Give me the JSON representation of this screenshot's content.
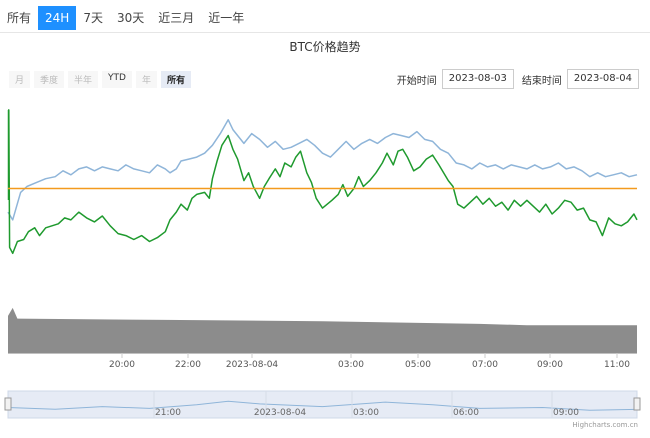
{
  "tabs": [
    {
      "label": "所有",
      "active": false
    },
    {
      "label": "24H",
      "active": true
    },
    {
      "label": "7天",
      "active": false
    },
    {
      "label": "30天",
      "active": false
    },
    {
      "label": "近三月",
      "active": false
    },
    {
      "label": "近一年",
      "active": false
    }
  ],
  "range_buttons": [
    {
      "label": "月",
      "state": "disabled"
    },
    {
      "label": "季度",
      "state": "disabled"
    },
    {
      "label": "半年",
      "state": "disabled"
    },
    {
      "label": "YTD",
      "state": "enabled"
    },
    {
      "label": "年",
      "state": "disabled"
    },
    {
      "label": "所有",
      "state": "selected"
    }
  ],
  "date_range": {
    "start_label": "开始时间",
    "start_value": "2023-08-03",
    "end_label": "结束时间",
    "end_value": "2023-08-04"
  },
  "credit": "Highcharts.com.cn",
  "colors": {
    "active_tab": "#1e90ff",
    "blue": "#8fb5d9",
    "green": "#1f9a2e",
    "orange": "#f39a1e",
    "volume": "#8c8c8c"
  },
  "chart_data": {
    "type": "line",
    "title": "BTC价格趋势",
    "x_start": "2023-08-03 18:30",
    "x_end": "2023-08-04 11:30",
    "x_tick_labels": [
      "20:00",
      "22:00",
      "2023-08-04",
      "03:00",
      "05:00",
      "07:00",
      "09:00",
      "11:00"
    ],
    "navigator_tick_labels": [
      "21:00",
      "2023-08-04",
      "03:00",
      "06:00",
      "09:00"
    ],
    "baseline": 0,
    "series": [
      {
        "color": "#8fb5d9",
        "points": [
          [
            0,
            -1.2
          ],
          [
            0.3,
            -1.6
          ],
          [
            0.8,
            -0.2
          ],
          [
            1.2,
            0.1
          ],
          [
            1.8,
            0.3
          ],
          [
            2.4,
            0.5
          ],
          [
            3.0,
            0.6
          ],
          [
            3.5,
            0.9
          ],
          [
            4.0,
            0.7
          ],
          [
            4.5,
            1.0
          ],
          [
            5.0,
            1.1
          ],
          [
            5.5,
            0.9
          ],
          [
            6.0,
            1.1
          ],
          [
            6.5,
            1.0
          ],
          [
            7.0,
            0.9
          ],
          [
            7.5,
            1.2
          ],
          [
            8.0,
            1.0
          ],
          [
            8.5,
            0.9
          ],
          [
            9.0,
            0.8
          ],
          [
            9.5,
            1.2
          ],
          [
            10.0,
            1.0
          ],
          [
            10.3,
            0.8
          ],
          [
            10.7,
            1.0
          ],
          [
            11.0,
            1.4
          ],
          [
            11.5,
            1.5
          ],
          [
            12.0,
            1.6
          ],
          [
            12.5,
            1.8
          ],
          [
            13.0,
            2.2
          ],
          [
            13.5,
            2.8
          ],
          [
            14.0,
            3.5
          ],
          [
            14.3,
            3.0
          ],
          [
            14.7,
            2.6
          ],
          [
            15.0,
            2.3
          ],
          [
            15.5,
            2.8
          ],
          [
            16.0,
            2.5
          ],
          [
            16.5,
            2.1
          ],
          [
            17.0,
            2.4
          ],
          [
            17.5,
            2.0
          ],
          [
            18.0,
            2.1
          ],
          [
            18.5,
            2.3
          ],
          [
            19.0,
            2.5
          ],
          [
            19.5,
            2.2
          ],
          [
            20.0,
            1.8
          ],
          [
            20.5,
            1.6
          ],
          [
            21.0,
            2.0
          ],
          [
            21.5,
            2.4
          ],
          [
            22.0,
            2.0
          ],
          [
            22.5,
            2.3
          ],
          [
            23.0,
            2.5
          ],
          [
            23.5,
            2.3
          ],
          [
            24.0,
            2.6
          ],
          [
            24.5,
            2.8
          ],
          [
            25.0,
            2.7
          ],
          [
            25.5,
            2.6
          ],
          [
            26.0,
            2.9
          ],
          [
            26.5,
            2.5
          ],
          [
            27.0,
            2.4
          ],
          [
            27.5,
            2.0
          ],
          [
            28.0,
            1.8
          ],
          [
            28.5,
            1.3
          ],
          [
            29.0,
            1.2
          ],
          [
            29.5,
            1.0
          ],
          [
            30.0,
            1.3
          ],
          [
            30.5,
            1.1
          ],
          [
            31.0,
            1.2
          ],
          [
            31.5,
            1.0
          ],
          [
            32.0,
            1.2
          ],
          [
            32.5,
            1.1
          ],
          [
            33.0,
            1.0
          ],
          [
            33.5,
            1.2
          ],
          [
            34.0,
            1.0
          ],
          [
            34.5,
            1.1
          ],
          [
            35.0,
            1.3
          ],
          [
            35.5,
            1.0
          ],
          [
            36.0,
            1.1
          ],
          [
            36.5,
            0.9
          ],
          [
            37.0,
            0.6
          ],
          [
            37.5,
            0.8
          ],
          [
            38.0,
            0.6
          ],
          [
            38.5,
            0.7
          ],
          [
            39.0,
            0.8
          ],
          [
            39.5,
            0.6
          ],
          [
            40.0,
            0.7
          ]
        ]
      },
      {
        "color": "#1f9a2e",
        "points": [
          [
            0,
            4.0
          ],
          [
            0.05,
            4.0
          ],
          [
            0.1,
            -3.0
          ],
          [
            0.3,
            -3.3
          ],
          [
            0.6,
            -2.7
          ],
          [
            1.0,
            -2.6
          ],
          [
            1.3,
            -2.2
          ],
          [
            1.7,
            -2.0
          ],
          [
            2.0,
            -2.4
          ],
          [
            2.4,
            -2.0
          ],
          [
            2.8,
            -1.9
          ],
          [
            3.2,
            -1.8
          ],
          [
            3.6,
            -1.5
          ],
          [
            4.0,
            -1.6
          ],
          [
            4.5,
            -1.2
          ],
          [
            5.0,
            -1.5
          ],
          [
            5.5,
            -1.7
          ],
          [
            6.0,
            -1.4
          ],
          [
            6.5,
            -1.9
          ],
          [
            7.0,
            -2.3
          ],
          [
            7.5,
            -2.4
          ],
          [
            8.0,
            -2.6
          ],
          [
            8.5,
            -2.4
          ],
          [
            9.0,
            -2.7
          ],
          [
            9.5,
            -2.5
          ],
          [
            10.0,
            -2.2
          ],
          [
            10.3,
            -1.6
          ],
          [
            10.7,
            -1.2
          ],
          [
            11.0,
            -0.8
          ],
          [
            11.4,
            -1.1
          ],
          [
            11.7,
            -0.5
          ],
          [
            12.0,
            -0.3
          ],
          [
            12.5,
            -0.2
          ],
          [
            12.8,
            -0.5
          ],
          [
            13.0,
            0.5
          ],
          [
            13.3,
            1.4
          ],
          [
            13.6,
            2.2
          ],
          [
            14.0,
            2.7
          ],
          [
            14.3,
            2.0
          ],
          [
            14.6,
            1.5
          ],
          [
            15.0,
            0.4
          ],
          [
            15.3,
            0.8
          ],
          [
            15.6,
            0.1
          ],
          [
            16.0,
            -0.5
          ],
          [
            16.3,
            0.1
          ],
          [
            16.6,
            0.5
          ],
          [
            17.0,
            1.0
          ],
          [
            17.3,
            0.6
          ],
          [
            17.6,
            1.3
          ],
          [
            18.0,
            1.1
          ],
          [
            18.3,
            1.6
          ],
          [
            18.6,
            1.9
          ],
          [
            19.0,
            0.8
          ],
          [
            19.3,
            0.3
          ],
          [
            19.6,
            -0.5
          ],
          [
            20.0,
            -1.0
          ],
          [
            20.3,
            -0.8
          ],
          [
            20.6,
            -0.6
          ],
          [
            21.0,
            -0.3
          ],
          [
            21.3,
            0.2
          ],
          [
            21.6,
            -0.4
          ],
          [
            22.0,
            0.0
          ],
          [
            22.3,
            0.6
          ],
          [
            22.6,
            0.1
          ],
          [
            23.0,
            0.4
          ],
          [
            23.4,
            0.8
          ],
          [
            23.8,
            1.3
          ],
          [
            24.1,
            1.8
          ],
          [
            24.5,
            1.2
          ],
          [
            24.8,
            1.9
          ],
          [
            25.1,
            2.0
          ],
          [
            25.4,
            1.6
          ],
          [
            25.8,
            0.9
          ],
          [
            26.2,
            1.1
          ],
          [
            26.6,
            1.5
          ],
          [
            27.0,
            1.7
          ],
          [
            27.4,
            1.2
          ],
          [
            27.7,
            0.8
          ],
          [
            28.0,
            0.4
          ],
          [
            28.3,
            0.1
          ],
          [
            28.6,
            -0.8
          ],
          [
            29.0,
            -1.0
          ],
          [
            29.4,
            -0.7
          ],
          [
            29.8,
            -0.4
          ],
          [
            30.2,
            -0.8
          ],
          [
            30.6,
            -0.5
          ],
          [
            31.0,
            -0.9
          ],
          [
            31.4,
            -0.7
          ],
          [
            31.8,
            -1.1
          ],
          [
            32.2,
            -0.6
          ],
          [
            32.6,
            -0.9
          ],
          [
            33.0,
            -0.6
          ],
          [
            33.4,
            -0.9
          ],
          [
            33.8,
            -1.2
          ],
          [
            34.2,
            -0.8
          ],
          [
            34.6,
            -1.3
          ],
          [
            35.0,
            -1.0
          ],
          [
            35.4,
            -0.6
          ],
          [
            35.8,
            -0.7
          ],
          [
            36.2,
            -1.1
          ],
          [
            36.6,
            -1.0
          ],
          [
            37.0,
            -1.6
          ],
          [
            37.4,
            -1.7
          ],
          [
            37.8,
            -2.4
          ],
          [
            38.2,
            -1.5
          ],
          [
            38.6,
            -1.8
          ],
          [
            39.0,
            -1.9
          ],
          [
            39.4,
            -1.7
          ],
          [
            39.8,
            -1.3
          ],
          [
            40.0,
            -1.6
          ]
        ]
      },
      {
        "color": "#f39a1e",
        "points": [
          [
            0,
            0
          ],
          [
            40,
            0
          ]
        ]
      }
    ],
    "volume": [
      [
        0,
        2.8
      ],
      [
        0.3,
        3.4
      ],
      [
        0.6,
        2.6
      ],
      [
        10,
        2.5
      ],
      [
        20,
        2.4
      ],
      [
        30,
        2.2
      ],
      [
        33,
        2.1
      ],
      [
        40,
        2.1
      ]
    ],
    "navigator": [
      [
        0,
        0.5
      ],
      [
        3,
        0.3
      ],
      [
        6,
        0.6
      ],
      [
        9,
        0.4
      ],
      [
        12,
        0.8
      ],
      [
        14,
        1.2
      ],
      [
        16,
        0.9
      ],
      [
        20,
        0.6
      ],
      [
        24,
        1.1
      ],
      [
        27,
        0.8
      ],
      [
        30,
        0.4
      ],
      [
        34,
        0.5
      ],
      [
        37,
        0.2
      ],
      [
        40,
        0.3
      ]
    ]
  }
}
